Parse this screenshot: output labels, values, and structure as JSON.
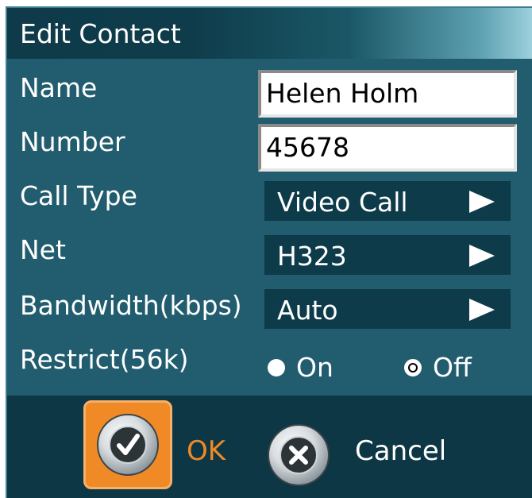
{
  "dialog": {
    "title": "Edit Contact",
    "fields": {
      "name": {
        "label": "Name",
        "value": "Helen Holm"
      },
      "number": {
        "label": "Number",
        "value": "45678"
      },
      "call_type": {
        "label": "Call Type",
        "value": "Video Call"
      },
      "net": {
        "label": "Net",
        "value": "H323"
      },
      "bandwidth": {
        "label": "Bandwidth(kbps)",
        "value": "Auto"
      },
      "restrict": {
        "label": "Restrict(56k)",
        "options": [
          {
            "label": "On",
            "selected": false
          },
          {
            "label": "Off",
            "selected": true
          }
        ]
      }
    },
    "buttons": {
      "ok": {
        "label": "OK",
        "icon": "check-icon"
      },
      "cancel": {
        "label": "Cancel",
        "icon": "close-icon"
      }
    }
  },
  "colors": {
    "panel": "#215d6e",
    "field_dark": "#0d3b4a",
    "accent": "#f08a26",
    "text": "#ffffff"
  }
}
